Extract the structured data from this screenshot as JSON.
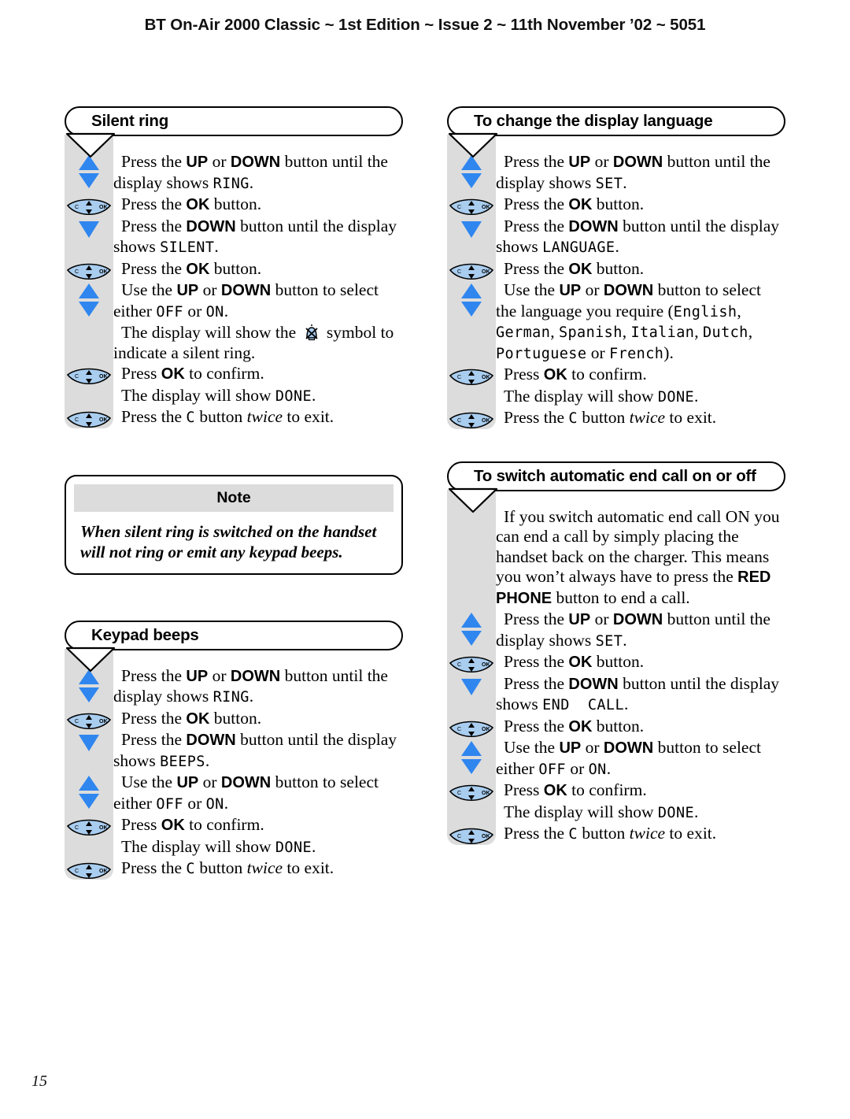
{
  "page": {
    "running_head": "BT On-Air 2000 Classic ~ 1st Edition ~ Issue 2 ~ 11th November ’02 ~ 5051",
    "folio": "15"
  },
  "icons": {
    "up_down": "up-down-arrows-icon",
    "down": "down-arrow-icon",
    "nav_key": "navigation-key-icon",
    "nav_key_left_label": "C",
    "nav_key_right_label": "OK",
    "silent_bell": "crossed-bell-icon"
  },
  "sections": {
    "silent_ring": {
      "title": "Silent ring",
      "steps": [
        {
          "icon": "up_down",
          "html": "Press the <b>UP</b> or <b>DOWN</b> button until the display shows <span class=\"lcd\">RING</span>."
        },
        {
          "icon": "nav_key",
          "html": "Press the <b>OK</b> button."
        },
        {
          "icon": "down",
          "html": "Press the <b>DOWN</b> button until the display shows <span class=\"lcd\">SILENT</span>."
        },
        {
          "icon": "nav_key",
          "html": "Press the <b>OK</b> button."
        },
        {
          "icon": "up_down",
          "html": "Use the <b>UP</b> or <b>DOWN</b> button to select either <span class=\"lcd\">OFF</span> or <span class=\"lcd\">ON</span>."
        },
        {
          "icon": "none",
          "html": "The display will show the @BELL@ symbol to indicate a silent ring."
        },
        {
          "icon": "nav_key",
          "html": "Press <b>OK</b> to confirm."
        },
        {
          "icon": "none",
          "html": "The display will show <span class=\"lcd\">DONE</span>."
        },
        {
          "icon": "nav_key",
          "html": "Press the <span class=\"lcd\">C</span> button <span class=\"it\">twice</span> to exit."
        }
      ]
    },
    "note": {
      "title": "Note",
      "body": "When silent ring is switched on the handset will not ring or emit any keypad beeps."
    },
    "keypad_beeps": {
      "title": "Keypad beeps",
      "steps": [
        {
          "icon": "up_down",
          "html": "Press the <b>UP</b> or <b>DOWN</b> button until the display shows <span class=\"lcd\">RING</span>."
        },
        {
          "icon": "nav_key",
          "html": "Press the <b>OK</b> button."
        },
        {
          "icon": "down",
          "html": "Press the <b>DOWN</b> button until the display shows <span class=\"lcd\">BEEPS</span>."
        },
        {
          "icon": "up_down",
          "html": "Use the <b>UP</b> or <b>DOWN</b> button to select either <span class=\"lcd\">OFF</span> or <span class=\"lcd\">ON</span>."
        },
        {
          "icon": "nav_key",
          "html": "Press <b>OK</b> to confirm."
        },
        {
          "icon": "none",
          "html": "The display will show <span class=\"lcd\">DONE</span>."
        },
        {
          "icon": "nav_key",
          "html": "Press the <span class=\"lcd\">C</span> button <span class=\"it\">twice</span> to exit."
        }
      ]
    },
    "display_language": {
      "title": "To change the display language",
      "steps": [
        {
          "icon": "up_down",
          "html": "Press the <b>UP</b> or <b>DOWN</b> button until the display shows <span class=\"lcd\">SET</span>."
        },
        {
          "icon": "nav_key",
          "html": "Press the <b>OK</b> button."
        },
        {
          "icon": "down",
          "html": "Press the <b>DOWN</b> button until the display shows <span class=\"lcd\">LANGUAGE</span>."
        },
        {
          "icon": "nav_key",
          "html": "Press the <b>OK</b> button."
        },
        {
          "icon": "up_down",
          "html": "Use the <b>UP</b> or <b>DOWN</b> button to select the language you require (<span class=\"lcd\">English</span>, <span class=\"lcd\">German</span>, <span class=\"lcd\">Spanish</span>, <span class=\"lcd\">Italian</span>, <span class=\"lcd\">Dutch</span>, <span class=\"lcd\">Portuguese</span> or <span class=\"lcd\">French</span>)."
        },
        {
          "icon": "nav_key",
          "html": "Press <b>OK</b> to confirm."
        },
        {
          "icon": "none",
          "html": "The display will show <span class=\"lcd\">DONE</span>."
        },
        {
          "icon": "nav_key",
          "html": "Press the <span class=\"lcd\">C</span> button <span class=\"it\">twice</span> to exit."
        }
      ]
    },
    "auto_end_call": {
      "title": "To switch automatic end call on or off",
      "steps": [
        {
          "icon": "none",
          "html": "If you switch automatic end call ON you can end a call by simply placing the handset back on the charger. This means you won’t always have to press the <b>RED PHONE</b> button to end a call."
        },
        {
          "icon": "up_down",
          "html": "Press the <b>UP</b> or <b>DOWN</b> button until the display shows <span class=\"lcd\">SET</span>."
        },
        {
          "icon": "nav_key",
          "html": "Press the <b>OK</b> button."
        },
        {
          "icon": "down",
          "html": "Press the <b>DOWN</b> button until the display shows <span class=\"lcd\">END&nbsp;&nbsp;CALL</span>."
        },
        {
          "icon": "nav_key",
          "html": "Press the <b>OK</b> button."
        },
        {
          "icon": "up_down",
          "html": "Use the <b>UP</b> or <b>DOWN</b> button to select either <span class=\"lcd\">OFF</span> or <span class=\"lcd\">ON</span>."
        },
        {
          "icon": "nav_key",
          "html": "Press <b>OK</b> to confirm."
        },
        {
          "icon": "none",
          "html": "The display will show <span class=\"lcd\">DONE</span>."
        },
        {
          "icon": "nav_key",
          "html": "Press the <span class=\"lcd\">C</span> button <span class=\"it\">twice</span> to exit."
        }
      ]
    }
  },
  "colors": {
    "arrow_blue": "#2f86ef",
    "key_fill": "#a9cdef",
    "gutter_grey": "#dcdcdc",
    "note_head_grey": "#dcdcdc"
  }
}
